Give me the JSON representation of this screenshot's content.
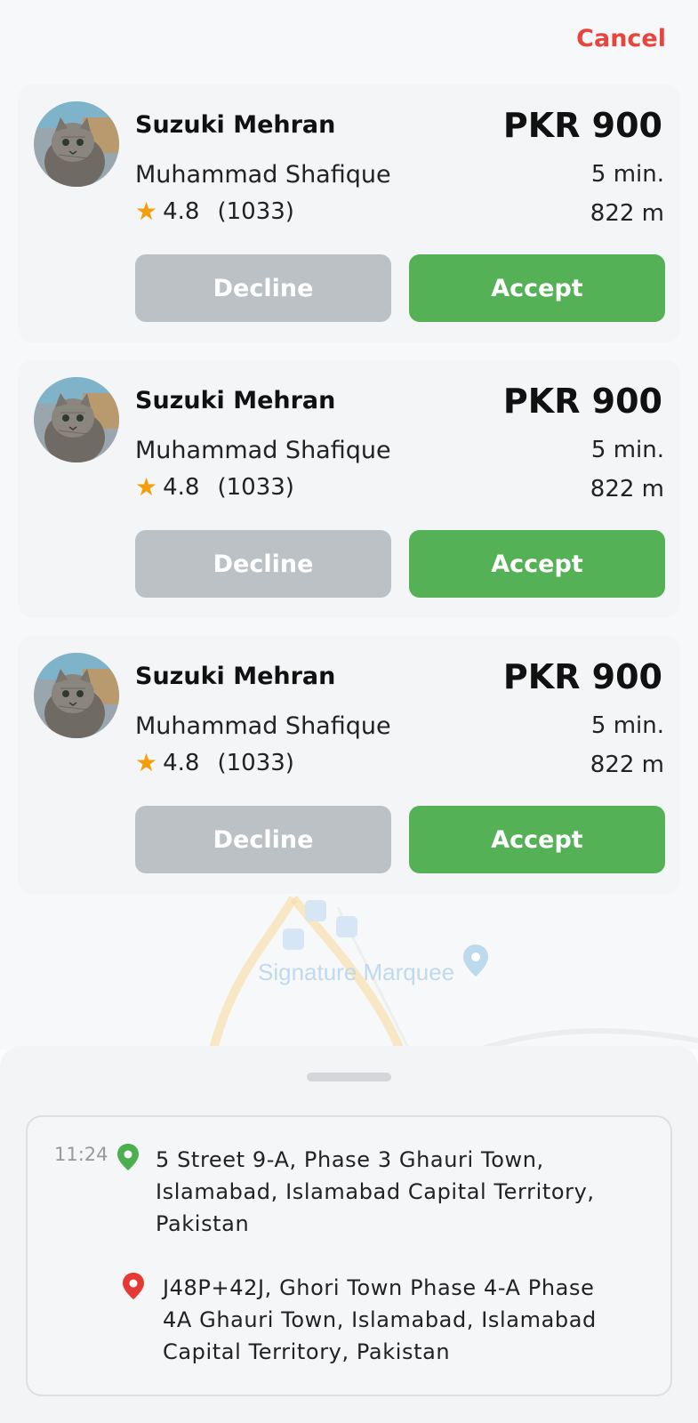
{
  "header": {
    "cancel_label": "Cancel"
  },
  "map": {
    "labels": [
      "Signature Marquee"
    ]
  },
  "offers": [
    {
      "car": "Suzuki Mehran",
      "price": "PKR 900",
      "driver": "Muhammad Shafique",
      "eta": "5 min.",
      "rating": "4.8",
      "rating_count": "(1033)",
      "distance": "822 m",
      "decline_label": "Decline",
      "accept_label": "Accept"
    },
    {
      "car": "Suzuki Mehran",
      "price": "PKR 900",
      "driver": "Muhammad Shafique",
      "eta": "5 min.",
      "rating": "4.8",
      "rating_count": "(1033)",
      "distance": "822 m",
      "decline_label": "Decline",
      "accept_label": "Accept"
    },
    {
      "car": "Suzuki Mehran",
      "price": "PKR 900",
      "driver": "Muhammad Shafique",
      "eta": "5 min.",
      "rating": "4.8",
      "rating_count": "(1033)",
      "distance": "822 m",
      "decline_label": "Decline",
      "accept_label": "Accept"
    }
  ],
  "route": {
    "time": "11:24",
    "pickup": {
      "icon": "green-location-pin-icon",
      "lines": [
        "5 Street 9-A, Phase 3 Ghauri Town,",
        "Islamabad, Islamabad Capital Territory,",
        "Pakistan"
      ]
    },
    "dropoff": {
      "icon": "red-location-pin-icon",
      "lines": [
        "J48P+42J, Ghori Town Phase 4-A Phase",
        "4A Ghauri Town, Islamabad, Islamabad",
        "Capital Territory, Pakistan"
      ]
    }
  },
  "colors": {
    "cancel": "#e8453c",
    "accept": "#55b155",
    "decline": "#bcc1c5",
    "star": "#f59e0b",
    "pickup_pin": "#4caf50",
    "dropoff_pin": "#e53935"
  }
}
